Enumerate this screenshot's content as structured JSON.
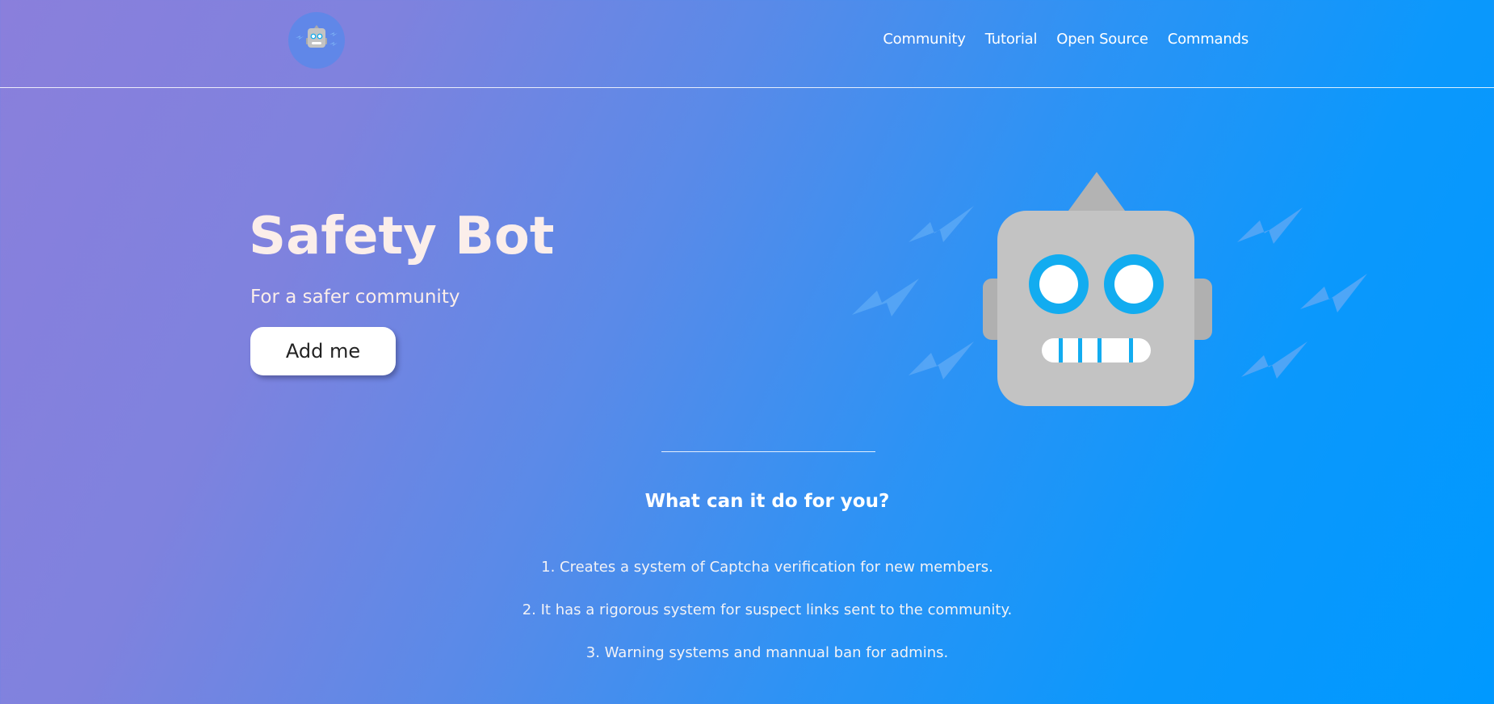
{
  "header": {
    "logo_icon": "robot-icon",
    "nav": [
      {
        "label": "Community"
      },
      {
        "label": "Tutorial"
      },
      {
        "label": "Open Source"
      },
      {
        "label": "Commands"
      }
    ]
  },
  "hero": {
    "title": "Safety Bot",
    "subtitle": "For a safer community",
    "cta_label": "Add me",
    "illustration_icon": "robot-icon"
  },
  "features": {
    "heading": "What can it do for you?",
    "items": [
      "1. Creates a system of Captcha verification for new members.",
      "2. It has a rigorous system for suspect links sent to the community.",
      "3. Warning systems and mannual ban for admins."
    ]
  },
  "colors": {
    "gradient_start": "#8a7fdc",
    "gradient_end": "#0099ff",
    "robot_grey": "#c3c3c3",
    "robot_eye_blue": "#12acf0",
    "lightning_blue": "#5aa8f6"
  }
}
